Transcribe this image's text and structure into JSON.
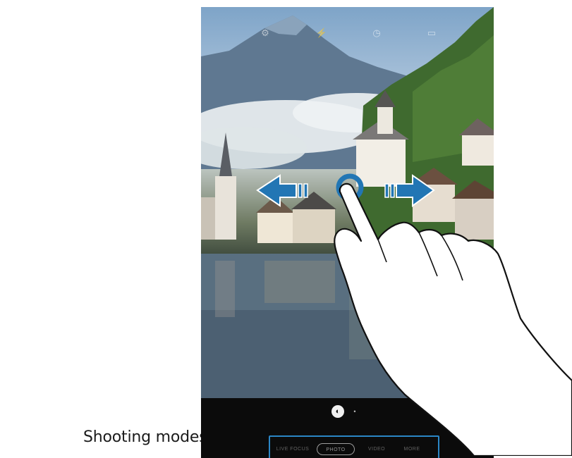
{
  "annotation": {
    "label": "Shooting modes list"
  },
  "camera": {
    "top_icons": [
      "settings-icon",
      "flash-icon",
      "timer-icon",
      "ratio-icon"
    ],
    "modes": [
      "LIVE FOCUS",
      "PHOTO",
      "VIDEO",
      "MORE"
    ],
    "selected_mode_index": 1
  },
  "gesture": {
    "type": "swipe-left-right",
    "arrow_color": "#2276b4"
  },
  "colors": {
    "highlight_border": "#2b86c6",
    "record_button": "#1ea4e8"
  }
}
